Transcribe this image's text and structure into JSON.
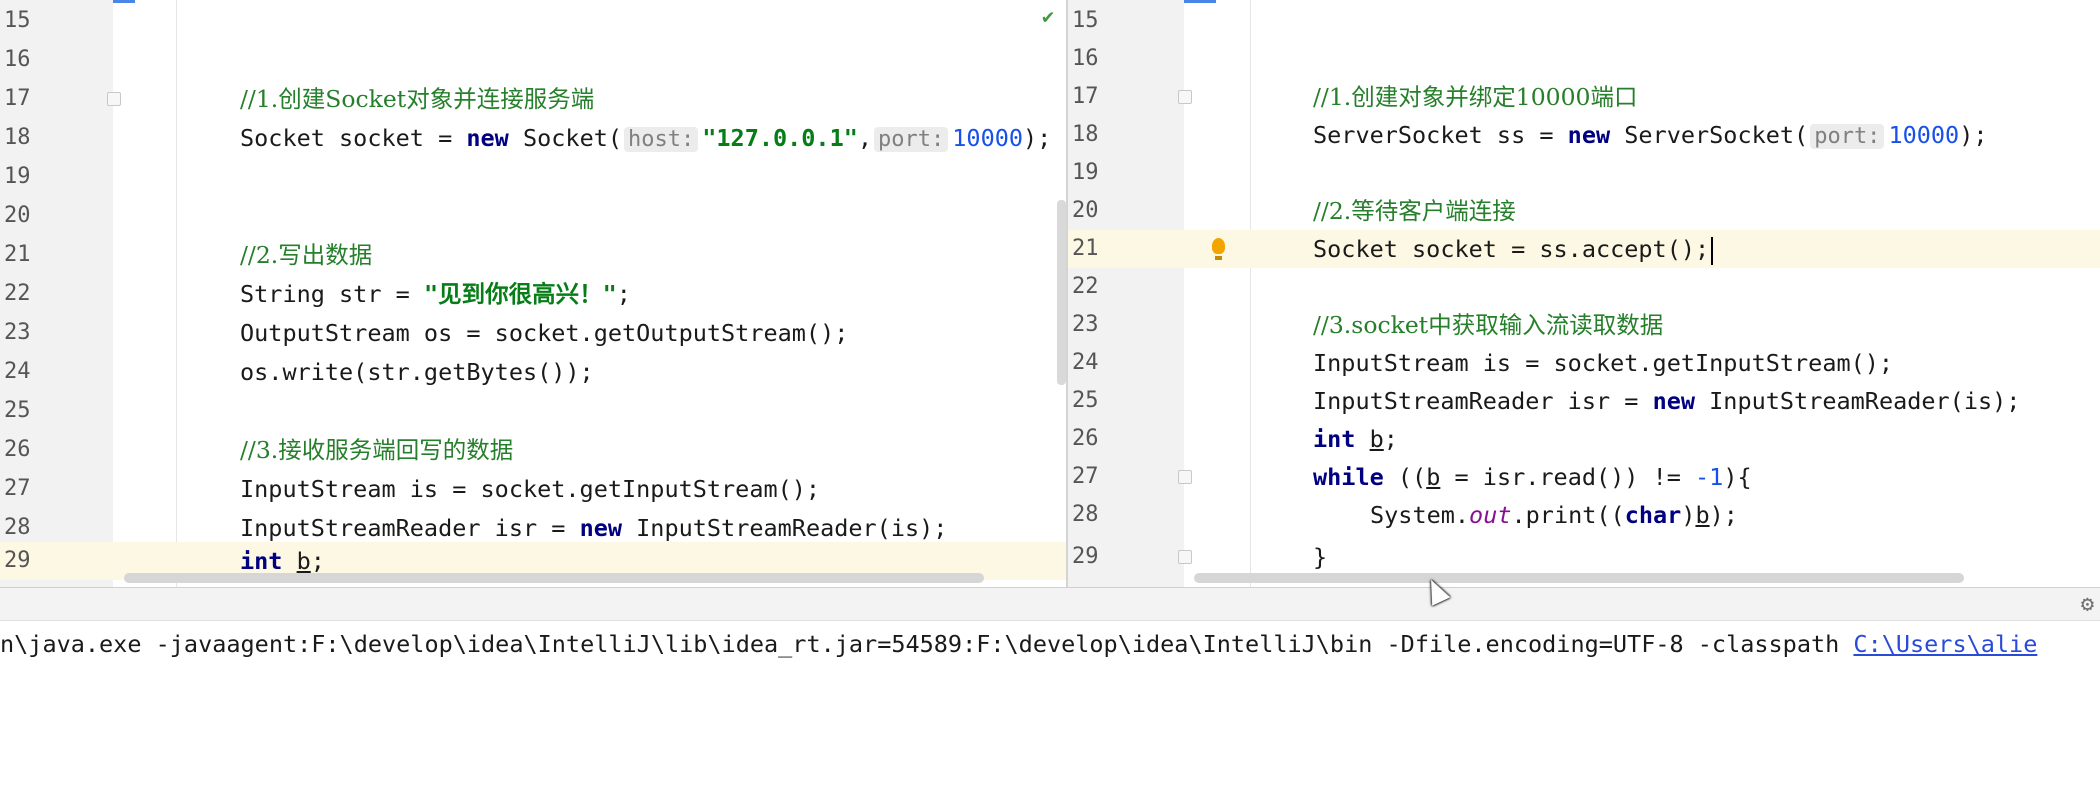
{
  "left_editor": {
    "lines": [
      {
        "n": "15"
      },
      {
        "n": "16"
      },
      {
        "n": "17",
        "comment": "//1.创建Socket对象并连接服务端"
      },
      {
        "n": "18",
        "t1": "Socket socket = ",
        "kw": "new",
        "t2": " Socket(",
        "hint_host": "host:",
        "str": "\"127.0.0.1\"",
        "t3": ",",
        "hint_port": "port:",
        "num": "10000",
        "t4": ");"
      },
      {
        "n": "19"
      },
      {
        "n": "20"
      },
      {
        "n": "21",
        "comment": "//2.写出数据"
      },
      {
        "n": "22",
        "t1": "String str = ",
        "str": "\"见到你很高兴！\"",
        "t2": ";"
      },
      {
        "n": "23",
        "text": "OutputStream os = socket.getOutputStream();"
      },
      {
        "n": "24",
        "text": "os.write(str.getBytes());"
      },
      {
        "n": "25"
      },
      {
        "n": "26",
        "comment": "//3.接收服务端回写的数据"
      },
      {
        "n": "27",
        "text": "InputStream is = socket.getInputStream();"
      },
      {
        "n": "28",
        "t1": "InputStreamReader isr = ",
        "kw": "new",
        "t2": " InputStreamReader(is);"
      },
      {
        "n": "29",
        "kw": "int",
        "t1": " ",
        "var": "b",
        "t2": ";"
      }
    ]
  },
  "right_editor": {
    "lines": [
      {
        "n": "15"
      },
      {
        "n": "16"
      },
      {
        "n": "17",
        "comment": "//1.创建对象并绑定10000端口"
      },
      {
        "n": "18",
        "t1": "ServerSocket ss = ",
        "kw": "new",
        "t2": " ServerSocket(",
        "hint_port": "port:",
        "num": "10000",
        "t3": ");"
      },
      {
        "n": "19"
      },
      {
        "n": "20",
        "comment": "//2.等待客户端连接"
      },
      {
        "n": "21",
        "text": "Socket socket = ss.accept();"
      },
      {
        "n": "22"
      },
      {
        "n": "23",
        "comment": "//3.socket中获取输入流读取数据"
      },
      {
        "n": "24",
        "text": "InputStream is = socket.getInputStream();"
      },
      {
        "n": "25",
        "t1": "InputStreamReader isr = ",
        "kw": "new",
        "t2": " InputStreamReader(is);"
      },
      {
        "n": "26",
        "kw": "int",
        "t1": " ",
        "var": "b",
        "t2": ";"
      },
      {
        "n": "27",
        "kw": "while",
        "t1": " ((",
        "var": "b",
        "t2": " = isr.read()) != ",
        "num": "-1",
        "t3": "){"
      },
      {
        "n": "28",
        "t1": "System.",
        "field": "out",
        "t2": ".print((",
        "kw": "char",
        "t3": ")",
        "var": "b",
        "t4": ");"
      },
      {
        "n": "29",
        "text": "}"
      }
    ]
  },
  "console": {
    "command": "n\\java.exe -javaagent:F:\\develop\\idea\\IntelliJ\\lib\\idea_rt.jar=54589:F:\\develop\\idea\\IntelliJ\\bin -Dfile.encoding=UTF-8 -classpath ",
    "classpath_link": "C:\\Users\\alie"
  },
  "icons": {
    "check": "checkmark-icon",
    "bulb": "lightbulb-icon",
    "gear": "gear-icon",
    "cursor": "mouse-cursor-icon"
  }
}
